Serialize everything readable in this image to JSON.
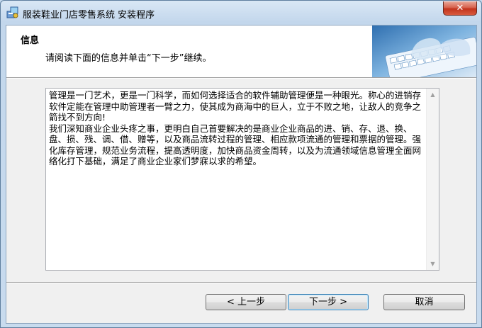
{
  "window": {
    "title": "服装鞋业门店零售系统 安装程序",
    "close_label": "✕"
  },
  "header": {
    "title": "信息",
    "subtitle": "请阅读下面的信息并单击“下一步”继续。",
    "image_icon": "keyboard-typing-image"
  },
  "info": {
    "text": "管理是一门艺术，更是一门科学，而如何选择适合的软件辅助管理便是一种眼光。称心的进销存软件定能在管理中助管理者一臂之力，使其成为商海中的巨人，立于不败之地，让敌人的竞争之箭找不到方向!\n我们深知商业企业头疼之事，更明白自己首要解决的是商业企业商品的进、销、存、退、换、盘、损、残、调、借、赠等，以及商品流转过程的管理、相应款项流通的管理和票据的管理。强化库存管理，规范业务流程，提高透明度，加快商品资金周转，以及为流通领域信息管理全面网络化打下基础，满足了商业企业家们梦寐以求的希望。",
    "scroll_up_icon": "▲",
    "scroll_down_icon": "▼"
  },
  "buttons": {
    "back": "< 上一步",
    "next": "下一步 >",
    "cancel": "取消"
  }
}
